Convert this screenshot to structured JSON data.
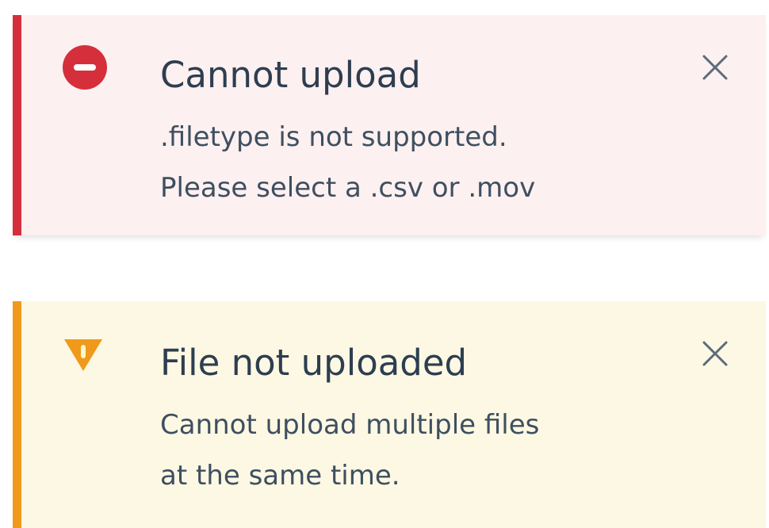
{
  "alerts": [
    {
      "type": "error",
      "icon": "error-circle-icon",
      "title": "Cannot upload",
      "body_lines": [
        ".filetype is not supported.",
        "Please select a .csv or .mov"
      ],
      "close_icon": "close-icon",
      "colors": {
        "accent": "#d52f3c",
        "background": "#fdf0f0"
      }
    },
    {
      "type": "warning",
      "icon": "warning-triangle-icon",
      "title": "File not uploaded",
      "body_lines": [
        "Cannot upload multiple files",
        "at the same time."
      ],
      "close_icon": "close-icon",
      "colors": {
        "accent": "#ef9a1b",
        "background": "#fdf8e3"
      }
    }
  ]
}
